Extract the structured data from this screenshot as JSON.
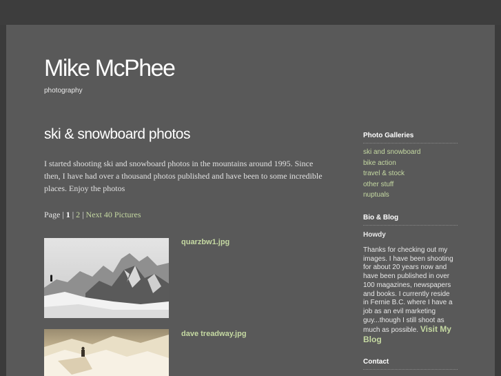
{
  "site": {
    "title": "Mike McPhee",
    "tagline": "photography"
  },
  "main": {
    "title": "ski & snowboard photos",
    "intro": "I started shooting ski and snowboard photos in the mountains around 1995. Since then, I have had over a thousand photos published and have been to some incredible places. Enjoy the photos",
    "pager": {
      "prefix": "Page",
      "current": "1",
      "sep": "|",
      "page2": "2",
      "next": "Next 40 Pictures"
    },
    "photos": [
      {
        "caption": "quarzbw1.jpg"
      },
      {
        "caption": "dave treadway.jpg"
      }
    ]
  },
  "sidebar": {
    "galleries_heading": "Photo Galleries",
    "galleries": [
      {
        "label": "ski and snowboard"
      },
      {
        "label": "bike action"
      },
      {
        "label": "travel & stock"
      },
      {
        "label": "other stuff"
      },
      {
        "label": "nuptuals"
      }
    ],
    "bio_heading": "Bio & Blog",
    "bio_subheading": "Howdy",
    "bio_text": "Thanks for checking out my images. I have been shooting for about 20 years now and have been published in over 100 magazines, newspapers and books. I currently reside in Fernie B.C. where I have a job as an evil marketing guy...though I still shoot as much as possible.",
    "bio_link": "Visit My Blog",
    "contact_heading": "Contact"
  },
  "colors": {
    "background": "#3b3b3b",
    "page": "#595959",
    "link": "#c5d9a2",
    "text": "#e8e8e8"
  }
}
